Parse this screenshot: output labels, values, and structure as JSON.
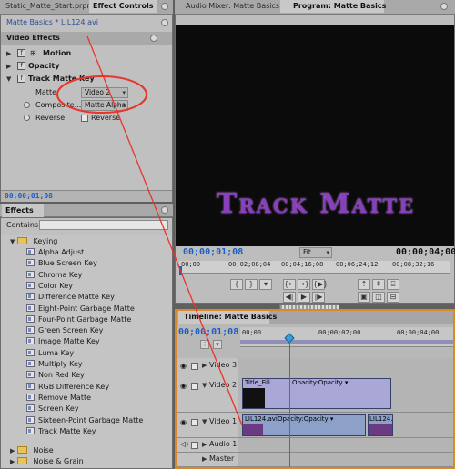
{
  "tabs_left": {
    "project_tab": "Static_Matte_Start.prproj",
    "effect_controls_tab": "Effect Controls"
  },
  "tabs_right": {
    "audio_mixer_tab": "Audio Mixer: Matte Basics",
    "program_tab": "Program: Matte Basics"
  },
  "effect_controls": {
    "breadcrumb": "Matte Basics * LIL124.avi",
    "section_title": "Video Effects",
    "motion_label": "Motion",
    "opacity_label": "Opacity",
    "track_matte_label": "Track Matte Key",
    "matte_label": "Matte:",
    "matte_value": "Video 2",
    "composite_label": "Composite...",
    "composite_value": "Matte Alpha",
    "reverse_label": "Reverse",
    "reverse_checkbox_label": "Reverse",
    "timecode": "00;00;01;08"
  },
  "program_monitor": {
    "display_text": "Track Matte",
    "current_time": "00;00;01;08",
    "fit_label": "Fit",
    "duration": "00;00;04;00",
    "ruler_labels": [
      "00;00",
      "00;02;08;04",
      "00;04;16;08",
      "00;06;24;12",
      "00;08;32;16"
    ]
  },
  "effects_panel": {
    "tab_label": "Effects",
    "contains_label": "Contains:",
    "contains_value": "",
    "keying_folder": "Keying",
    "keying_items": [
      "Alpha Adjust",
      "Blue Screen Key",
      "Chroma Key",
      "Color Key",
      "Difference Matte Key",
      "Eight-Point Garbage Matte",
      "Four-Point Garbage Matte",
      "Green Screen Key",
      "Image Matte Key",
      "Luma Key",
      "Multiply Key",
      "Non Red Key",
      "RGB Difference Key",
      "Remove Matte",
      "Screen Key",
      "Sixteen-Point Garbage Matte",
      "Track Matte Key"
    ],
    "other_folders": [
      "Noise",
      "Noise & Grain"
    ]
  },
  "timeline": {
    "tab_label": "Timeline: Matte Basics",
    "timecode": "00;00;01;08",
    "ruler_labels": [
      "00;00",
      "00;00;02;00",
      "00;00;04;00"
    ],
    "tracks": {
      "video3": "Video 3",
      "video2": "Video 2",
      "video1": "Video 1",
      "audio1": "Audio 1",
      "master": "Master"
    },
    "clips": {
      "title_clip": "Title_Fill",
      "title_opacity": "Opacity:Opacity ▾",
      "video_clip": "LIL124.avi",
      "video_opacity": "Opacity:Opacity ▾",
      "right_clip": "LIL124."
    }
  },
  "colors": {
    "accent_timecode": "#1a5fc8",
    "annotation_red": "#e8352c",
    "title_text_purple": "#8a3fc0"
  }
}
